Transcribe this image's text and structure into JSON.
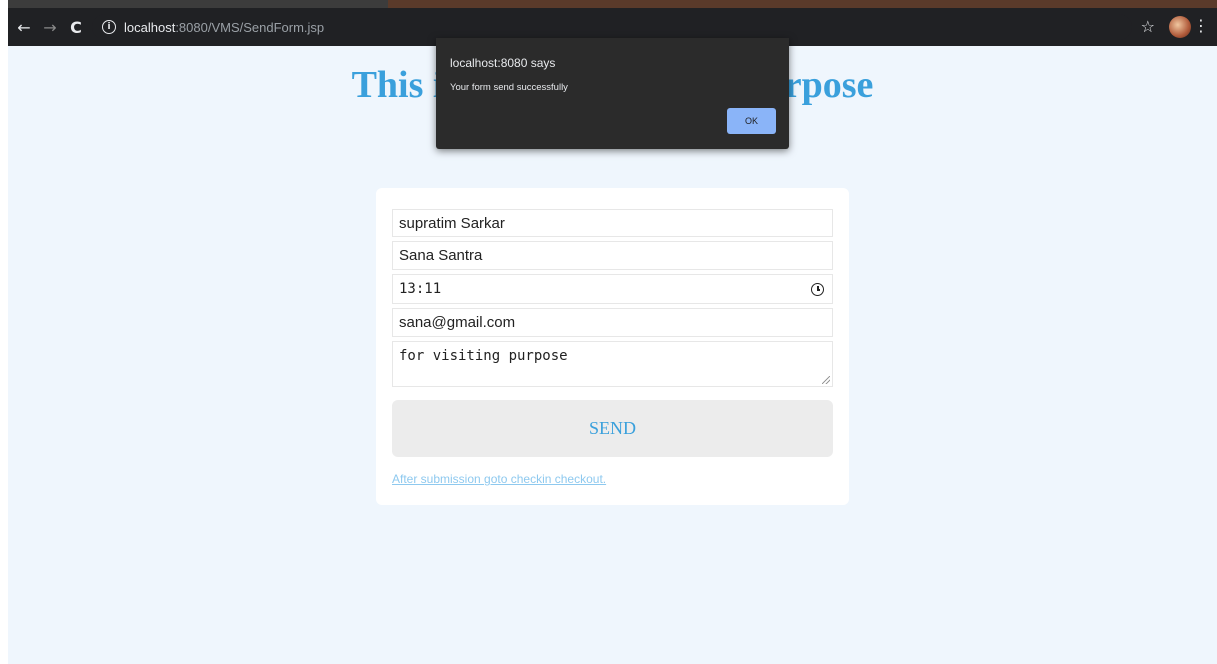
{
  "browser": {
    "url_host": "localhost",
    "url_path": ":8080/VMS/SendForm.jsp",
    "back_icon": "←",
    "forward_icon": "→",
    "reload_icon": "C",
    "star_icon": "☆",
    "menu_icon": "⋮"
  },
  "page": {
    "heading": "This is form for visiting purpose"
  },
  "form": {
    "host_name": "supratim Sarkar",
    "visitor_name": "Sana Santra",
    "time": "13:11",
    "email": "sana@gmail.com",
    "purpose": "for visiting purpose",
    "send_label": "SEND",
    "footer_link": "After submission goto checkin checkout."
  },
  "dialog": {
    "title": "localhost:8080 says",
    "message": "Your form send successfully",
    "ok_label": "OK"
  },
  "colors": {
    "accent": "#3aa0dc",
    "page_bg": "#eff6fd",
    "dialog_bg": "#2b2b2b",
    "ok_button": "#8ab4f8"
  }
}
